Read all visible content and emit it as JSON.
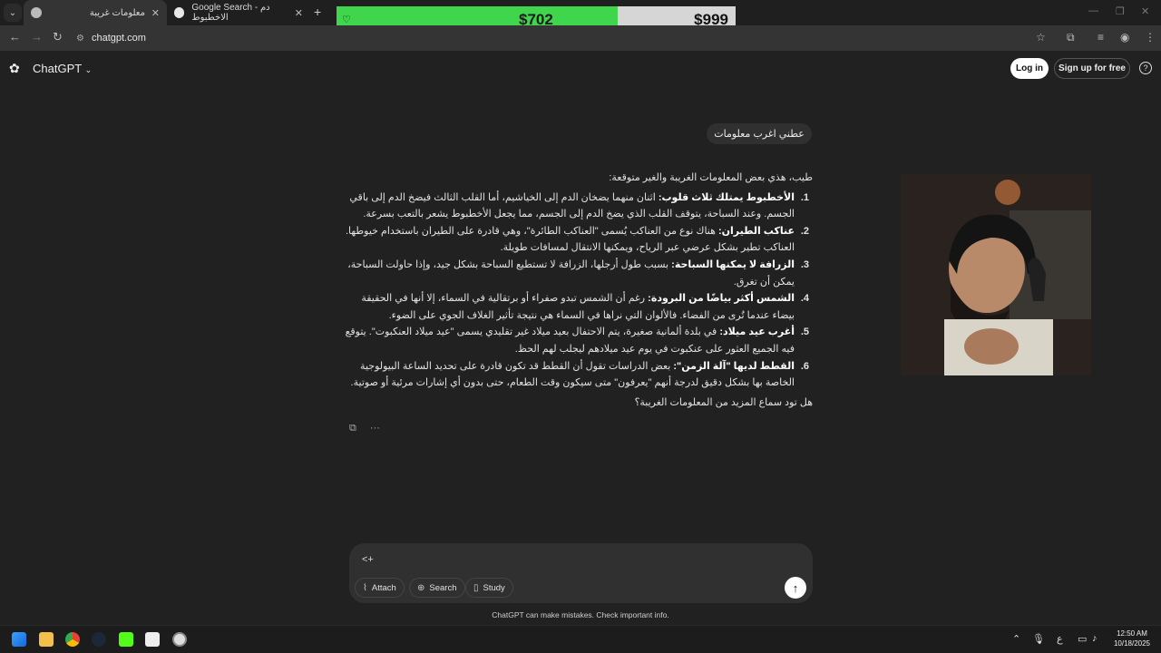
{
  "browser": {
    "tabs": [
      {
        "title": "معلومات غريبة",
        "active": true
      },
      {
        "title": "Google Search - دم الاخطبوط",
        "active": false
      }
    ],
    "url": "chatgpt.com"
  },
  "header": {
    "app_name": "ChatGPT",
    "login_label": "Log in",
    "signup_label": "Sign up for free"
  },
  "price_overlay": {
    "current": "$702",
    "target": "$999"
  },
  "conversation": {
    "user_message": "عطني اغرب معلومات",
    "intro": "طيب، هذي بعض المعلومات الغريبة والغير متوقعة:",
    "items": [
      {
        "num": "1.",
        "title": "الأخطبوط يمتلك ثلاث قلوب:",
        "text": " اثنان منهما يضخان الدم إلى الخياشيم، أما القلب الثالث فيضخ الدم إلى باقي الجسم. وعند السباحة، يتوقف القلب الذي يضخ الدم إلى الجسم، مما يجعل الأخطبوط يشعر بالتعب بسرعة."
      },
      {
        "num": "2.",
        "title": "عناكب الطيران:",
        "text": " هناك نوع من العناكب يُسمى \"العناكب الطائرة\"، وهي قادرة على الطيران باستخدام خيوطها. العناكب تطير بشكل عرضي عبر الرياح، ويمكنها الانتقال لمسافات طويلة."
      },
      {
        "num": "3.",
        "title": "الزرافة لا يمكنها السباحة:",
        "text": " بسبب طول أرجلها، الزرافة لا تستطيع السباحة بشكل جيد، وإذا حاولت السباحة، يمكن أن تغرق."
      },
      {
        "num": "4.",
        "title": "الشمس أكثر بياضًا من البرودة:",
        "text": " رغم أن الشمس تبدو صفراء أو برتقالية في السماء، إلا أنها في الحقيقة بيضاء عندما تُرى من الفضاء. فالألوان التي نراها في السماء هي نتيجة تأثير الغلاف الجوي على الضوء."
      },
      {
        "num": "5.",
        "title": "أغرب عيد ميلاد:",
        "text": " في بلدة ألمانية صغيرة، يتم الاحتفال بعيد ميلاد غير تقليدي يسمى \"عيد ميلاد العنكبوت\". يتوقع فيه الجميع العثور على عنكبوت في يوم عيد ميلادهم ليجلب لهم الحظ."
      },
      {
        "num": "6.",
        "title": "القطط لديها \"آلة الزمن\":",
        "text": " بعض الدراسات تقول أن القطط قد تكون قادرة على تحديد الساعة البيولوجية الخاصة بها بشكل دقيق لدرجة أنهم \"يعرفون\" متى سيكون وقت الطعام، حتى بدون أي إشارات مرئية أو صوتية."
      }
    ],
    "outro": "هل تود سماع المزيد من المعلومات الغريبة؟"
  },
  "composer": {
    "input_text": "<+",
    "attach_label": "Attach",
    "search_label": "Search",
    "study_label": "Study"
  },
  "footer": {
    "disclaimer": "ChatGPT can make mistakes. Check important info."
  },
  "taskbar": {
    "time": "12:50 AM",
    "date": "10/18/2025",
    "lang": "ع"
  }
}
